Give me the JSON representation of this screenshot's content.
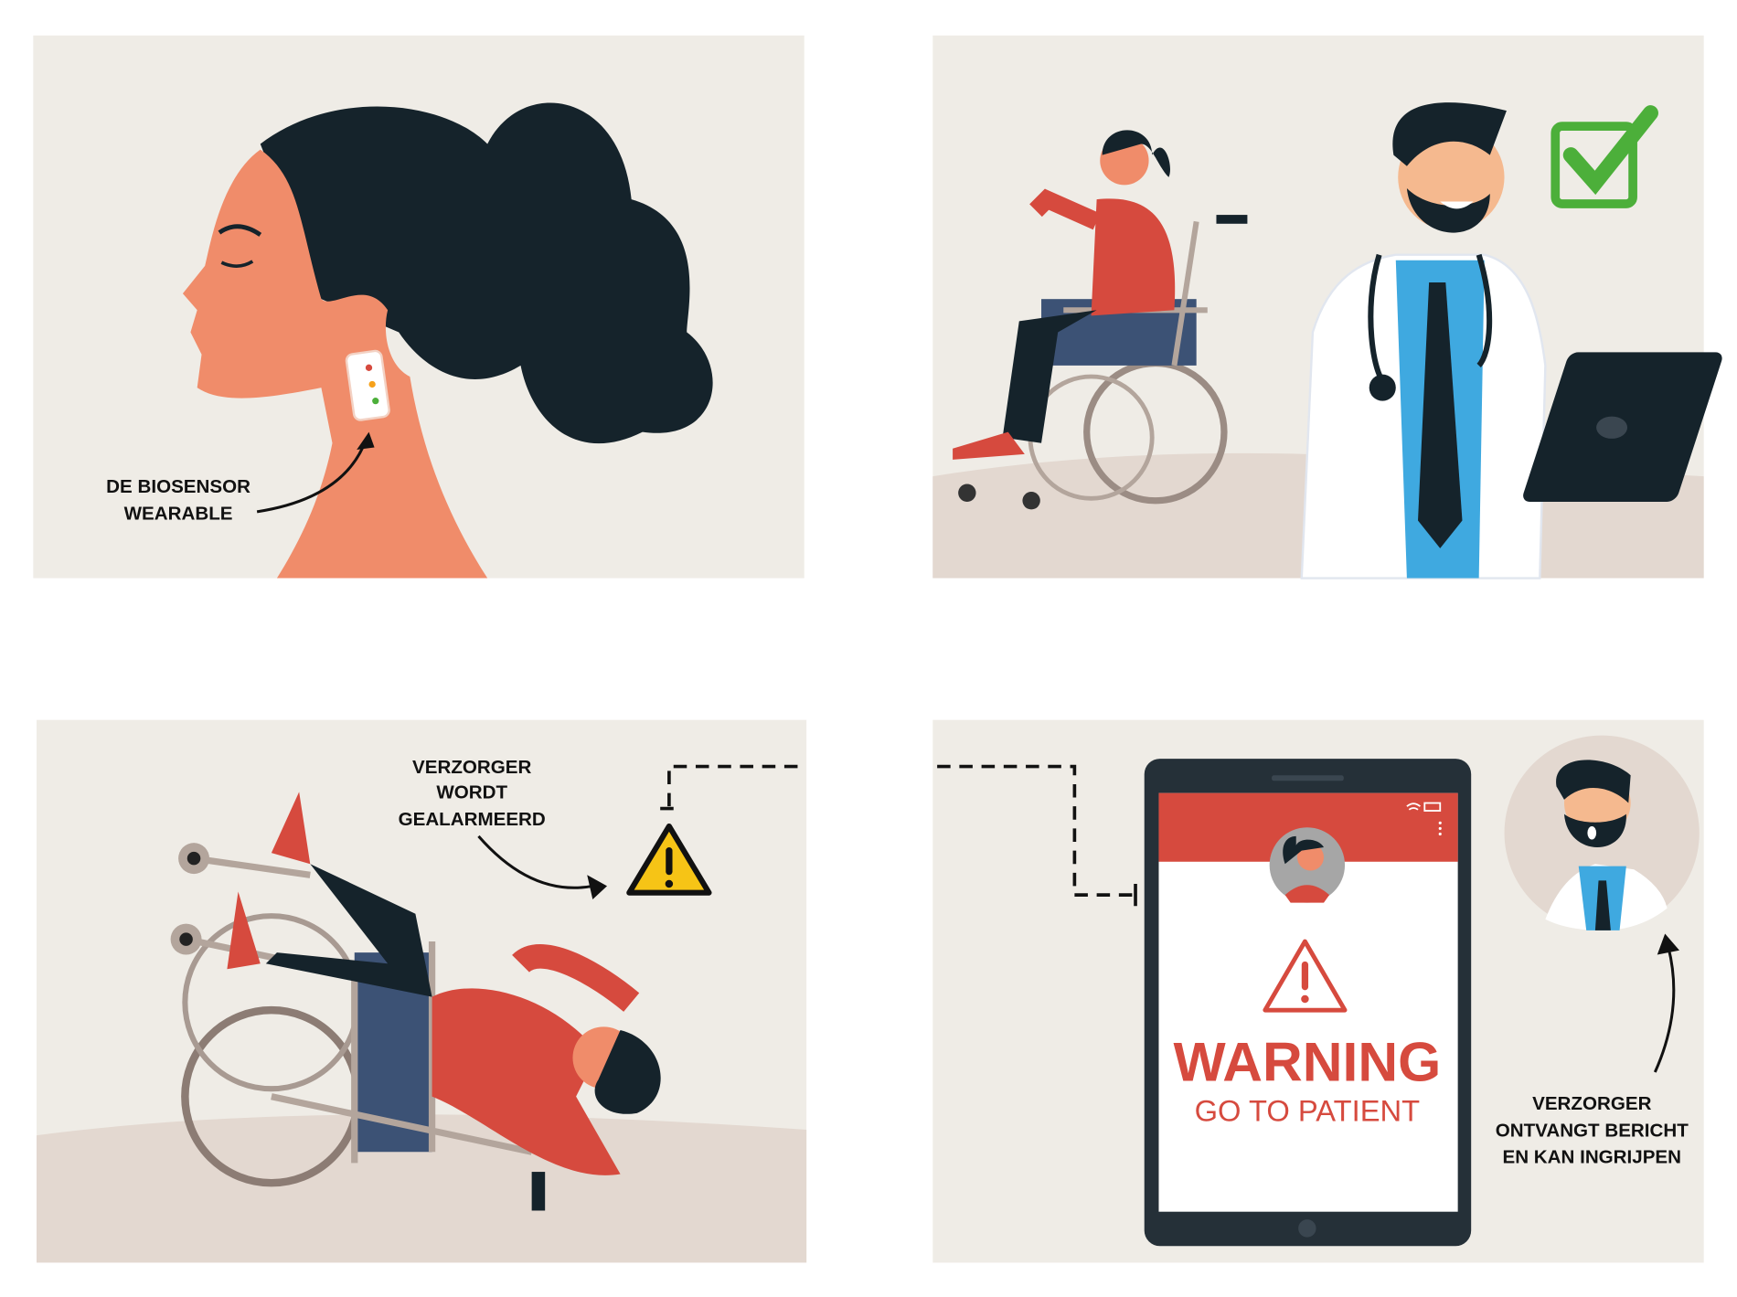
{
  "panels": {
    "biosensor": {
      "label_line1": "DE BIOSENSOR",
      "label_line2": "WEARABLE"
    },
    "doctor": {
      "check_icon": "checkmark-icon"
    },
    "fall": {
      "label_line1": "VERZORGER",
      "label_line2": "WORDT",
      "label_line3": "GEALARMEERD",
      "alert_icon": "warning-triangle-icon"
    },
    "tablet": {
      "title": "WARNING",
      "subtitle": "GO TO PATIENT",
      "label_line1": "VERZORGER",
      "label_line2": "ONTVANGT BERICHT",
      "label_line3": "EN KAN INGRIJPEN"
    }
  },
  "colors": {
    "panel_bg": "#efece6",
    "floor": "#e3d8d0",
    "hair": "#15232b",
    "skin": "#f08c6a",
    "red": "#d64a3e",
    "yellow": "#f6c416",
    "green": "#4caf3a",
    "blue": "#3fa9e0",
    "tablet": "#253038"
  }
}
